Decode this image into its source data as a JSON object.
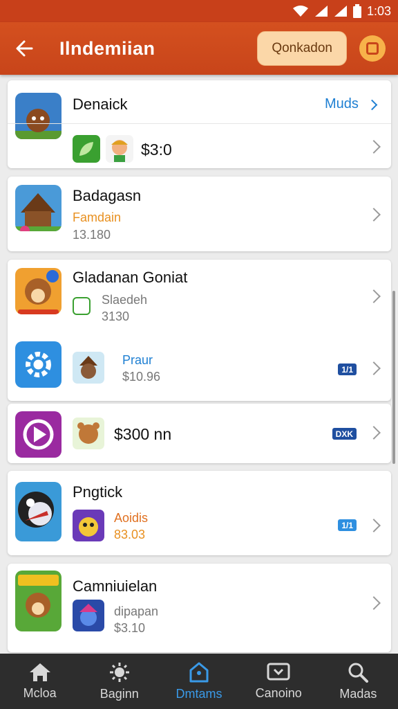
{
  "status_bar": {
    "time": "1:03"
  },
  "header": {
    "title": "Ilndemiian",
    "action_label": "Qonkadon"
  },
  "colors": {
    "primary": "#c8451a",
    "accent": "#1e7fd2",
    "nav_bg": "#2d2d2d",
    "nav_active": "#3a9ae8"
  },
  "cards": [
    {
      "title": "Denaick",
      "link_label": "Muds",
      "price": "$3:0"
    },
    {
      "title": "Badagasn",
      "tag": "Famdain",
      "price": "13.180"
    },
    {
      "title": "Gladanan Goniat",
      "tag": "Slaedeh",
      "price": "3130",
      "sub_title": "Praur",
      "sub_price": "$10.96",
      "sub_badge": "1/1"
    },
    {
      "price": "$300 nn",
      "badge": "DXK"
    },
    {
      "title": "Pngtick",
      "tag": "Aoidis",
      "price": "83.03",
      "badge": "1/1"
    },
    {
      "title": "Camniuielan",
      "tag": "dipapan",
      "price": "$3.10"
    }
  ],
  "bottom_nav": [
    {
      "label": "Mcloa",
      "icon": "home-icon"
    },
    {
      "label": "Baginn",
      "icon": "sun-icon"
    },
    {
      "label": "Dmtams",
      "icon": "bookmark-house-icon",
      "active": true
    },
    {
      "label": "Canoino",
      "icon": "tv-icon"
    },
    {
      "label": "Madas",
      "icon": "search-icon"
    }
  ]
}
